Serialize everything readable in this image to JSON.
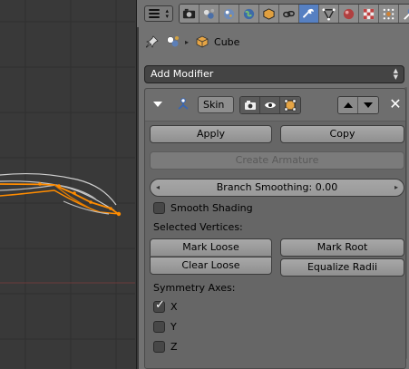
{
  "viewport": {
    "background": "#393939",
    "selection_color": "#ff8c00"
  },
  "properties": {
    "tabs": [
      {
        "icon": "render-icon",
        "active": false
      },
      {
        "icon": "render-layers-icon",
        "active": false
      },
      {
        "icon": "scene-icon",
        "active": false
      },
      {
        "icon": "world-icon",
        "active": false
      },
      {
        "icon": "object-icon",
        "active": false
      },
      {
        "icon": "constraints-icon",
        "active": false
      },
      {
        "icon": "modifiers-wrench-icon",
        "active": true
      },
      {
        "icon": "object-data-icon",
        "active": false
      },
      {
        "icon": "material-icon",
        "active": false
      },
      {
        "icon": "texture-icon",
        "active": false
      },
      {
        "icon": "particles-icon",
        "active": false
      },
      {
        "icon": "physics-icon",
        "active": false
      }
    ],
    "breadcrumb": {
      "object_name": "Cube"
    },
    "add_modifier_label": "Add Modifier",
    "modifier": {
      "name": "Skin",
      "apply_label": "Apply",
      "copy_label": "Copy",
      "create_armature_label": "Create Armature",
      "branch_smoothing_label": "Branch Smoothing: 0.00",
      "smooth_shading_label": "Smooth Shading",
      "smooth_shading_checked": false,
      "selected_vertices_label": "Selected Vertices:",
      "mark_loose_label": "Mark Loose",
      "clear_loose_label": "Clear Loose",
      "mark_root_label": "Mark Root",
      "equalize_radii_label": "Equalize Radii",
      "symmetry_axes_label": "Symmetry Axes:",
      "axes": [
        {
          "label": "X",
          "checked": true
        },
        {
          "label": "Y",
          "checked": false
        },
        {
          "label": "Z",
          "checked": false
        }
      ]
    }
  }
}
